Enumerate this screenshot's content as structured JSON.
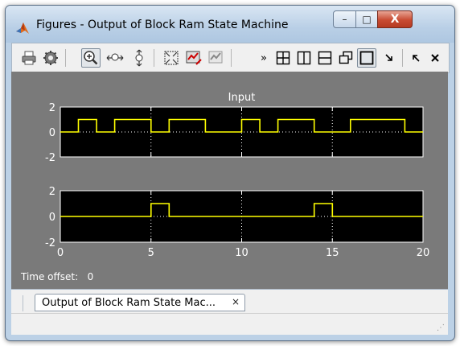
{
  "window": {
    "title": "Figures - Output of Block Ram  State Machine",
    "controls": {
      "minimize": "–",
      "maximize": "□",
      "close": "X"
    }
  },
  "toolbar": {
    "buttons": [
      "print",
      "settings",
      "zoom",
      "zoom-x",
      "zoom-y",
      "fit",
      "dock-left",
      "dock-right"
    ],
    "overflow": "»",
    "pressed": [
      "zoom",
      "single-layout"
    ]
  },
  "figure": {
    "time_offset_label": "Time offset:",
    "time_offset_value": "0"
  },
  "tabs": [
    {
      "label": "Output of Block Ram  State Mac...",
      "close": "×"
    }
  ],
  "colors": {
    "plot_bg": "#000000",
    "figure_bg": "#7a7a7a",
    "trace": "#ffff00",
    "axis_text": "#ffffff"
  },
  "chart_data": [
    {
      "type": "line",
      "title": "Input",
      "xlim": [
        0,
        20
      ],
      "ylim": [
        -2,
        2
      ],
      "yticks": [
        -2,
        0,
        2
      ],
      "xticks": [
        0,
        5,
        10,
        15,
        20
      ],
      "show_xtick_labels": false,
      "grid": true,
      "x": [
        0,
        1,
        1,
        2,
        2,
        3,
        3,
        5,
        5,
        6,
        6,
        8,
        8,
        10,
        10,
        11,
        11,
        12,
        12,
        14,
        14,
        15,
        15,
        16,
        16,
        19,
        19,
        20
      ],
      "y": [
        0,
        0,
        1,
        1,
        0,
        0,
        1,
        1,
        0,
        0,
        1,
        1,
        0,
        0,
        1,
        1,
        0,
        0,
        1,
        1,
        0,
        0,
        0,
        0,
        1,
        1,
        0,
        0
      ]
    },
    {
      "type": "line",
      "title": "",
      "xlim": [
        0,
        20
      ],
      "ylim": [
        -2,
        2
      ],
      "yticks": [
        -2,
        0,
        2
      ],
      "xticks": [
        0,
        5,
        10,
        15,
        20
      ],
      "show_xtick_labels": true,
      "grid": true,
      "x": [
        0,
        5,
        5,
        6,
        6,
        14,
        14,
        15,
        15,
        20
      ],
      "y": [
        0,
        0,
        1,
        1,
        0,
        0,
        1,
        1,
        0,
        0
      ]
    }
  ]
}
